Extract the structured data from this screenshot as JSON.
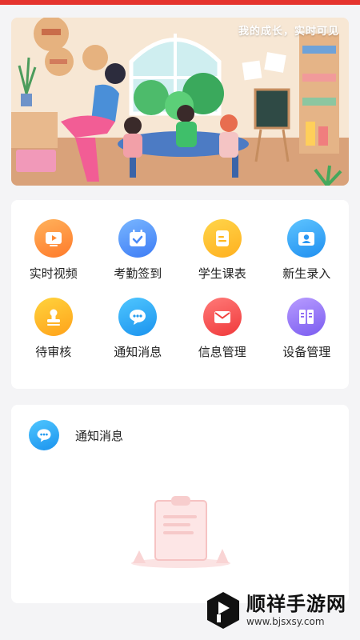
{
  "banner": {
    "slogan": "我的成长，实时可见"
  },
  "menu": [
    {
      "label": "实时视频",
      "icon": "play-video-icon",
      "color": "#ff8a33"
    },
    {
      "label": "考勤签到",
      "icon": "calendar-check-icon",
      "color": "#4a8af7"
    },
    {
      "label": "学生课表",
      "icon": "schedule-card-icon",
      "color": "#ffb820"
    },
    {
      "label": "新生录入",
      "icon": "user-card-icon",
      "color": "#2a97f2"
    },
    {
      "label": "待审核",
      "icon": "stamp-icon",
      "color": "#ffad22"
    },
    {
      "label": "通知消息",
      "icon": "chat-bubble-icon",
      "color": "#249bf0"
    },
    {
      "label": "信息管理",
      "icon": "envelope-icon",
      "color": "#f2423f"
    },
    {
      "label": "设备管理",
      "icon": "server-cabinet-icon",
      "color": "#8a66f3"
    }
  ],
  "notice": {
    "title": "通知消息",
    "icon": "chat-bubble-icon"
  },
  "watermark": {
    "name": "顺祥手游网",
    "url": "www.bjsxsy.com"
  },
  "colors": {
    "accent_red": "#e5342e",
    "background": "#f4f4f6"
  }
}
